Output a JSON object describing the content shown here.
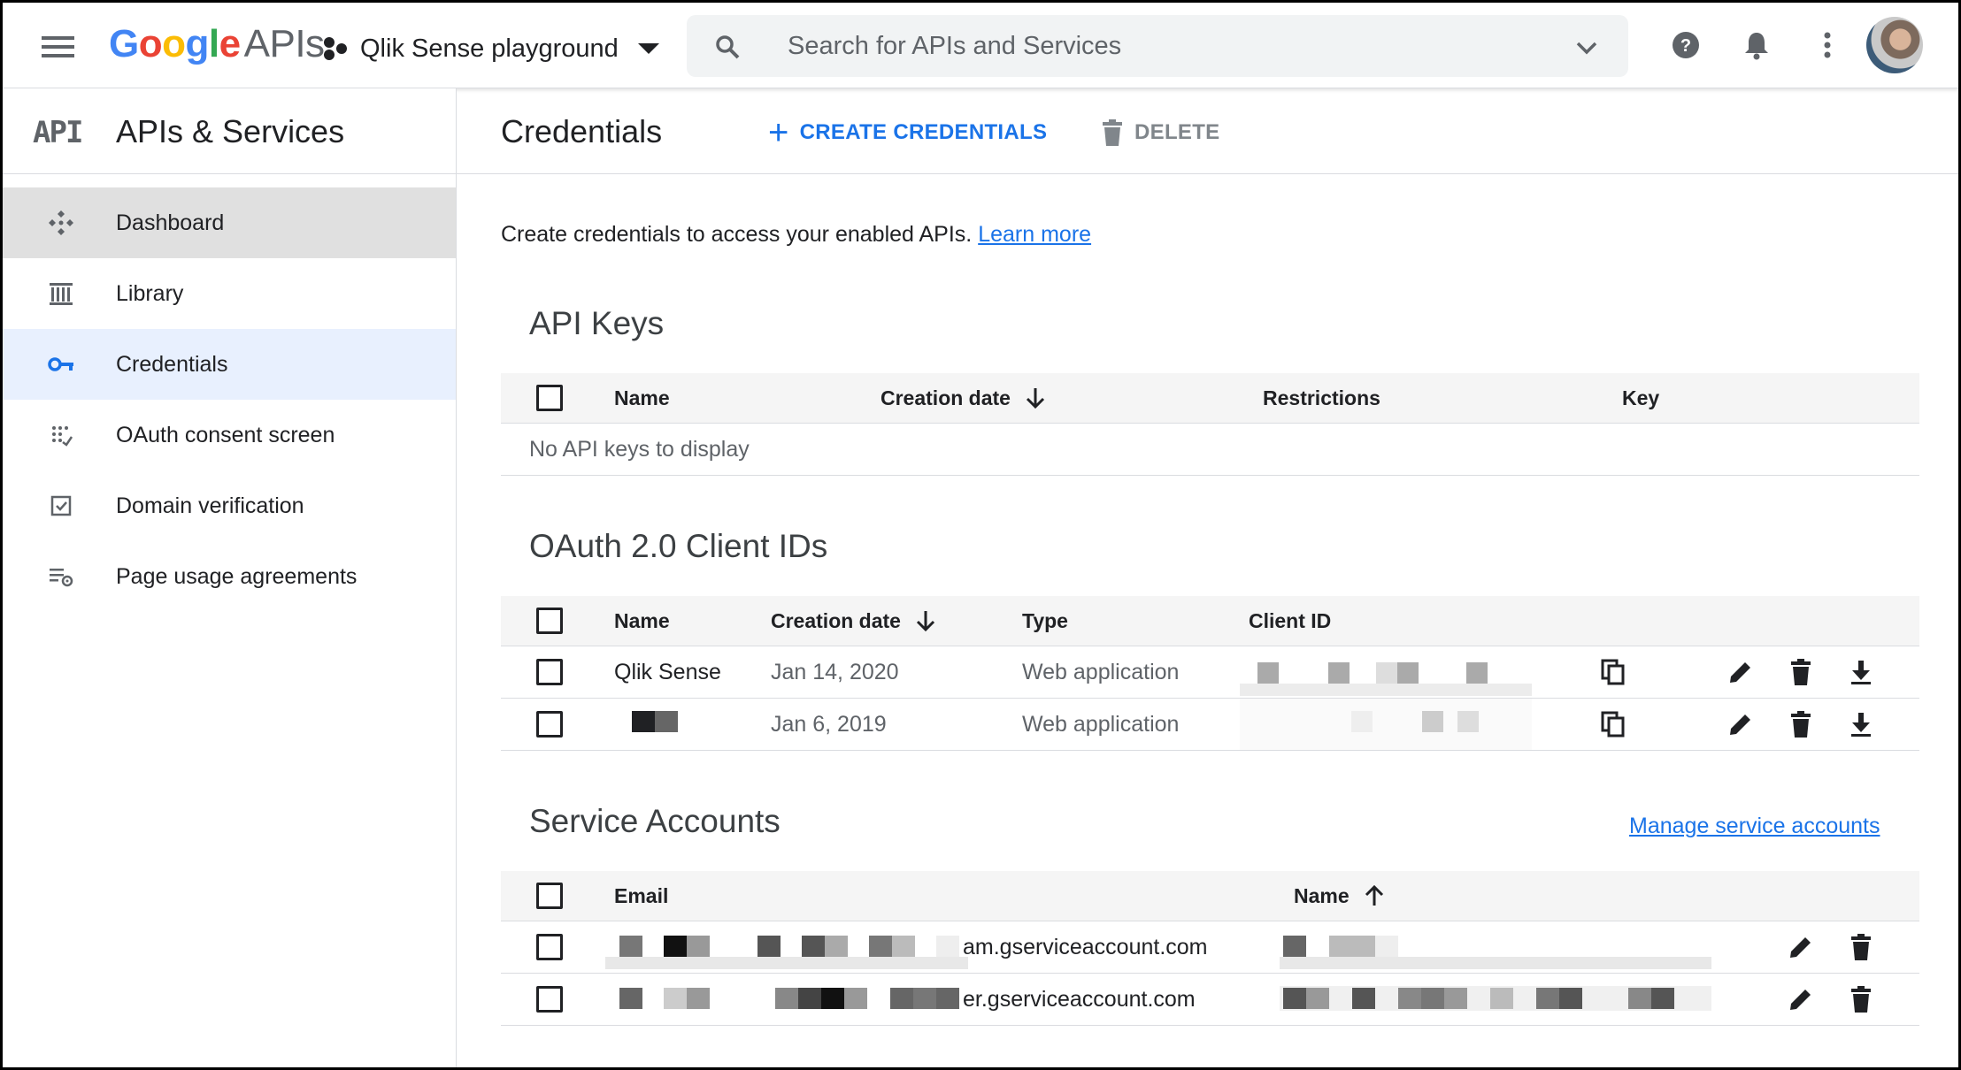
{
  "header": {
    "logo_google": "Google",
    "logo_apis": "APIs",
    "project_name": "Qlik Sense playground",
    "search_placeholder": "Search for APIs and Services"
  },
  "icons": {
    "menu": "hamburger-menu-icon",
    "project": "project-icon",
    "search": "search-icon",
    "expand": "chevron-down-icon",
    "help": "help-icon",
    "notifications": "bell-icon",
    "more": "more-vert-icon",
    "copy": "copy-icon",
    "edit": "pencil-icon",
    "delete": "trash-icon",
    "download": "download-icon"
  },
  "sidebar": {
    "logo_text": "API",
    "title": "APIs & Services",
    "items": [
      {
        "label": "Dashboard",
        "icon": "dashboard-icon"
      },
      {
        "label": "Library",
        "icon": "library-icon"
      },
      {
        "label": "Credentials",
        "icon": "key-icon",
        "active": true
      },
      {
        "label": "OAuth consent screen",
        "icon": "consent-icon"
      },
      {
        "label": "Domain verification",
        "icon": "checkbox-icon"
      },
      {
        "label": "Page usage agreements",
        "icon": "settings-list-icon"
      }
    ]
  },
  "main": {
    "title": "Credentials",
    "create_label": "CREATE CREDENTIALS",
    "delete_label": "DELETE",
    "intro_text": "Create credentials to access your enabled APIs.",
    "learn_more": "Learn more",
    "api_keys": {
      "title": "API Keys",
      "columns": [
        "Name",
        "Creation date",
        "Restrictions",
        "Key"
      ],
      "empty": "No API keys to display"
    },
    "oauth": {
      "title": "OAuth 2.0 Client IDs",
      "columns": [
        "Name",
        "Creation date",
        "Type",
        "Client ID"
      ],
      "rows": [
        {
          "name": "Qlik Sense",
          "date": "Jan 14, 2020",
          "type": "Web application"
        },
        {
          "name": "",
          "date": "Jan 6, 2019",
          "type": "Web application"
        }
      ]
    },
    "service_accounts": {
      "title": "Service Accounts",
      "manage_link": "Manage service accounts",
      "columns": [
        "Email",
        "Name"
      ],
      "rows": [
        {
          "email_suffix": "am.gserviceaccount.com"
        },
        {
          "email_suffix": "er.gserviceaccount.com"
        }
      ]
    }
  },
  "colors": {
    "accent": "#1a73e8",
    "active_nav_bg": "#e8f0fe",
    "hover_nav_bg": "#e0e0e0",
    "table_header_bg": "#f5f5f5"
  }
}
